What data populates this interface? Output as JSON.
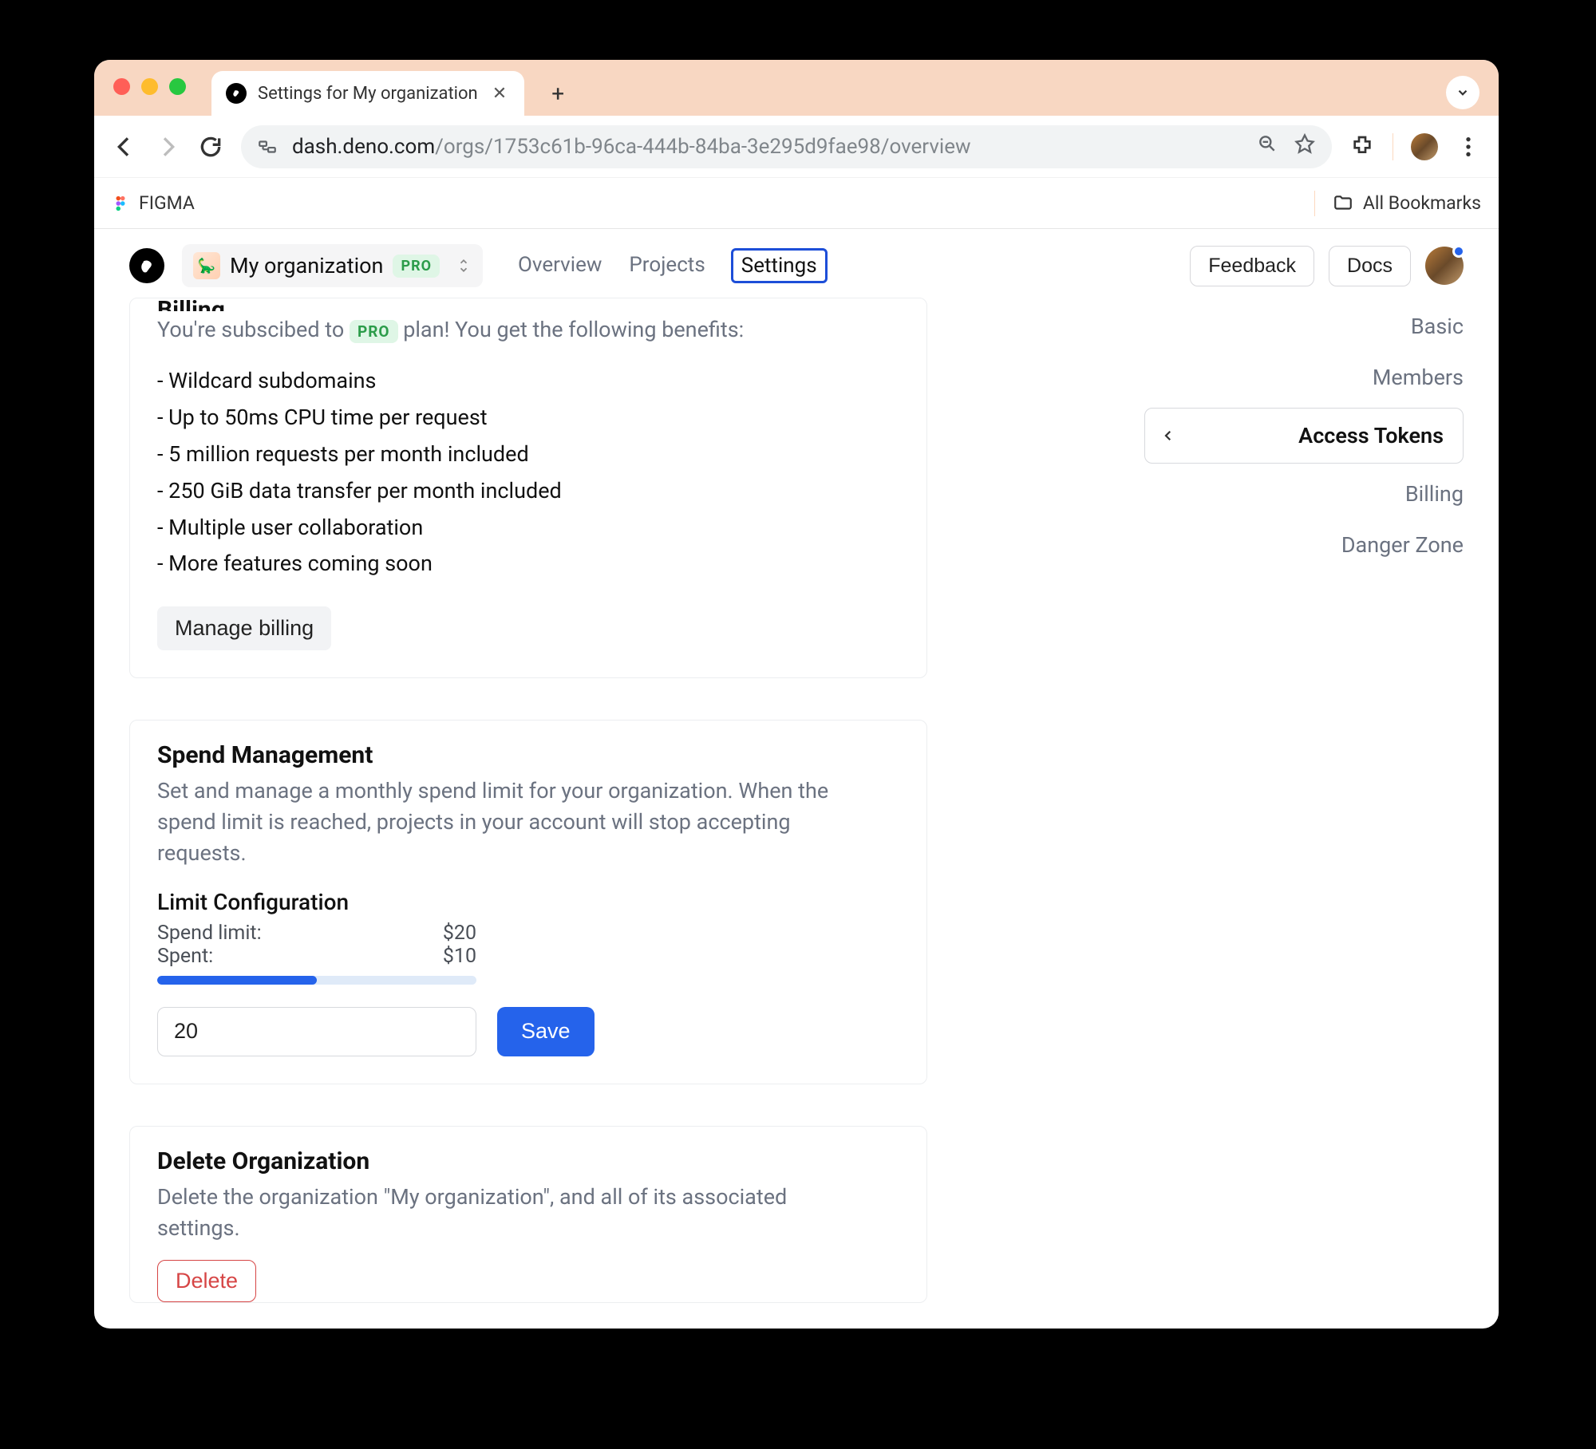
{
  "browser": {
    "tab_title": "Settings for My organization",
    "url_host": "dash.deno.com",
    "url_path": "/orgs/1753c61b-96ca-444b-84ba-3e295d9fae98/overview",
    "bookmark_figma": "FIGMA",
    "all_bookmarks": "All Bookmarks"
  },
  "header": {
    "org_name": "My organization",
    "pro_badge": "PRO",
    "nav": {
      "overview": "Overview",
      "projects": "Projects",
      "settings": "Settings"
    },
    "feedback": "Feedback",
    "docs": "Docs"
  },
  "sidebar": {
    "basic": "Basic",
    "members": "Members",
    "access_tokens": "Access Tokens",
    "billing": "Billing",
    "danger_zone": "Danger Zone"
  },
  "billing": {
    "title": "Billing",
    "subscribed_prefix": "You're subscibed to ",
    "subscribed_suffix": " plan! You get the following benefits:",
    "pro_badge": "PRO",
    "benefits": [
      "- Wildcard subdomains",
      "- Up to 50ms CPU time per request",
      "- 5 million requests per month included",
      "- 250 GiB data transfer per month included",
      "- Multiple user collaboration",
      "- More features coming soon"
    ],
    "manage_btn": "Manage billing"
  },
  "spend": {
    "title": "Spend Management",
    "desc": "Set and manage a monthly spend limit for your organization. When the spend limit is reached, projects in your account will stop accepting requests.",
    "limit_title": "Limit Configuration",
    "spend_limit_label": "Spend limit:",
    "spend_limit_value": "$20",
    "spent_label": "Spent:",
    "spent_value": "$10",
    "progress_pct": 50,
    "input_value": "20",
    "save_btn": "Save"
  },
  "delete": {
    "title": "Delete Organization",
    "desc": "Delete the organization \"My organization\", and all of its associated settings.",
    "delete_btn": "Delete"
  }
}
